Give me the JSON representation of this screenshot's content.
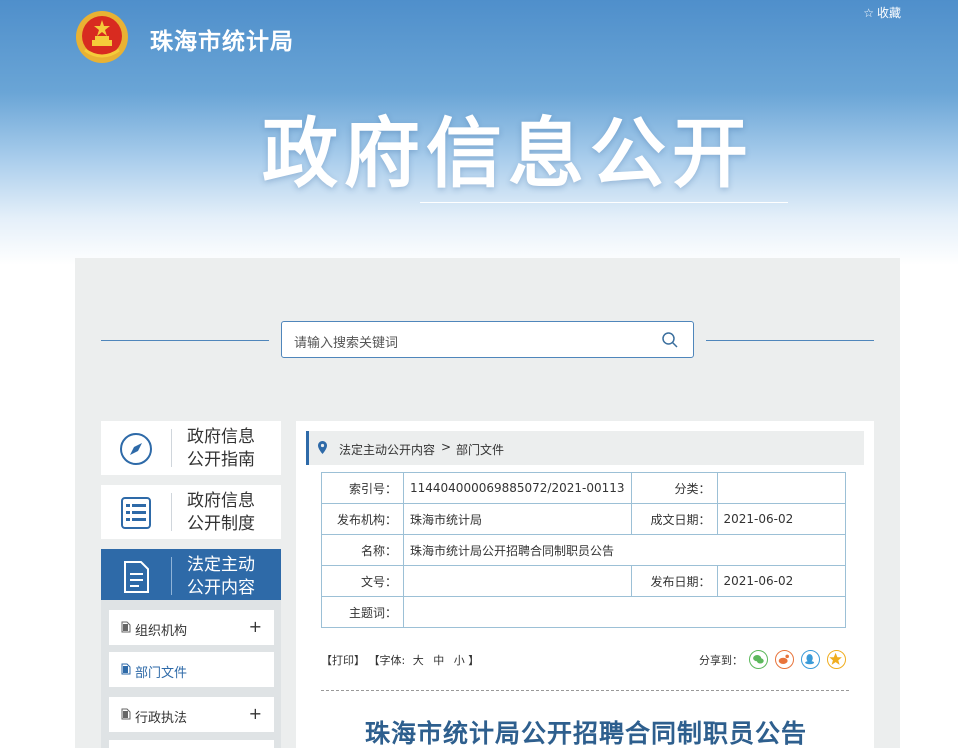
{
  "header": {
    "site_name": "珠海市统计局",
    "favorite_label": "收藏",
    "banner_title": "政府信息公开"
  },
  "search": {
    "placeholder": "请输入搜索关键词"
  },
  "sidebar": {
    "nav": [
      {
        "line1": "政府信息",
        "line2": "公开指南"
      },
      {
        "line1": "政府信息",
        "line2": "公开制度"
      },
      {
        "line1": "法定主动",
        "line2": "公开内容"
      }
    ],
    "sub_items": [
      {
        "label": "组织机构",
        "expand": "+"
      },
      {
        "label": "部门文件"
      },
      {
        "label": "行政执法",
        "expand": "+"
      }
    ]
  },
  "breadcrumb": {
    "items": [
      "法定主动公开内容",
      "部门文件"
    ],
    "separator": ">"
  },
  "meta": {
    "index_label": "索引号：",
    "index_value": "114404000069885072/2021-00113",
    "category_label": "分类：",
    "category_value": "",
    "issuer_label": "发布机构：",
    "issuer_value": "珠海市统计局",
    "created_label": "成文日期：",
    "created_value": "2021-06-02",
    "name_label": "名称：",
    "name_value": "珠海市统计局公开招聘合同制职员公告",
    "docno_label": "文号：",
    "docno_value": "",
    "published_label": "发布日期：",
    "published_value": "2021-06-02",
    "subject_label": "主题词：",
    "subject_value": ""
  },
  "tools": {
    "print": "【打印】",
    "font_prefix": "【字体:",
    "font_large": "大",
    "font_medium": "中",
    "font_small": "小",
    "font_suffix": "】",
    "share_label": "分享到："
  },
  "share_colors": {
    "wechat": "#5cb85c",
    "weibo": "#e8743b",
    "qq": "#3a9bd9",
    "qzone": "#f0ad1e"
  },
  "article": {
    "title": "珠海市统计局公开招聘合同制职员公告"
  }
}
